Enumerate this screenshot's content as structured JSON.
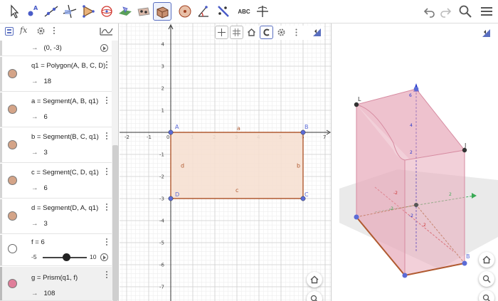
{
  "toolbar": {
    "tools": [
      {
        "name": "move-tool-icon"
      },
      {
        "name": "point-tool-icon"
      },
      {
        "name": "line-tool-icon"
      },
      {
        "name": "perpendicular-tool-icon"
      },
      {
        "name": "polygon-tool-icon"
      },
      {
        "name": "circle-tool-icon"
      },
      {
        "name": "plane-tool-icon"
      },
      {
        "name": "intersect-tool-icon"
      },
      {
        "name": "prism-tool-icon",
        "active": true
      },
      {
        "name": "sphere-tool-icon"
      },
      {
        "name": "angle-tool-icon"
      },
      {
        "name": "reflect-tool-icon"
      },
      {
        "name": "text-tool-icon",
        "label": "ABC"
      },
      {
        "name": "rotate-view-tool-icon"
      }
    ],
    "right_icons": [
      "undo-icon",
      "redo-icon",
      "search-icon",
      "menu-icon"
    ]
  },
  "algebra": {
    "header_icons": [
      "algebra-view-icon",
      "input-fx-icon",
      "gear-icon",
      "more-icon"
    ],
    "rows": [
      {
        "id": "partial",
        "value": "(0, -3)"
      },
      {
        "id": "q1",
        "definition": "q1 = Polygon(A, B, C, D)",
        "value": "18",
        "color": "#d4a488"
      },
      {
        "id": "a",
        "definition": "a = Segment(A, B, q1)",
        "value": "6",
        "color": "#d4a488"
      },
      {
        "id": "b",
        "definition": "b = Segment(B, C, q1)",
        "value": "3",
        "color": "#d4a488"
      },
      {
        "id": "c",
        "definition": "c = Segment(C, D, q1)",
        "value": "6",
        "color": "#d4a488"
      },
      {
        "id": "d",
        "definition": "d = Segment(D, A, q1)",
        "value": "3",
        "color": "#d4a488"
      },
      {
        "id": "f",
        "definition": "f = 6",
        "slider_min": "-5",
        "slider_max": "10",
        "slider_value": 6
      },
      {
        "id": "g",
        "definition": "g = Prism(q1, f)",
        "value": "108",
        "color": "#e07e9a"
      }
    ],
    "arrow": "→"
  },
  "graphics2d": {
    "x_ticks": [
      "-2",
      "-1",
      "0",
      "1",
      "2",
      "3",
      "4",
      "5",
      "6",
      "7"
    ],
    "y_ticks": [
      "4",
      "3",
      "2",
      "1",
      "-1",
      "-2",
      "-3",
      "-4",
      "-5",
      "-6",
      "-7"
    ],
    "points": [
      {
        "label": "A",
        "x": 0,
        "y": 0
      },
      {
        "label": "B",
        "x": 6,
        "y": 0
      },
      {
        "label": "C",
        "x": 6,
        "y": -3
      },
      {
        "label": "D",
        "x": 0,
        "y": -3
      }
    ],
    "segment_labels": {
      "a": "a",
      "b": "b",
      "c": "c",
      "d": "d"
    },
    "polygon_fill": "#f6e0d2",
    "polygon_stroke": "#b05a30",
    "point_color": "#5b6bd6"
  },
  "graphics3d": {
    "point_labels": {
      "L": "L",
      "J": "J",
      "B": "B"
    },
    "axis_ticks": [
      "2",
      "4",
      "6",
      "-2",
      "2",
      "-2",
      "2",
      "-2"
    ],
    "prism_fill": "#e8a9ba",
    "prism_stroke": "#d68aa0",
    "z_axis_color": "#2233cc",
    "x_axis_color": "#cc2222",
    "y_axis_color": "#22aa44"
  }
}
